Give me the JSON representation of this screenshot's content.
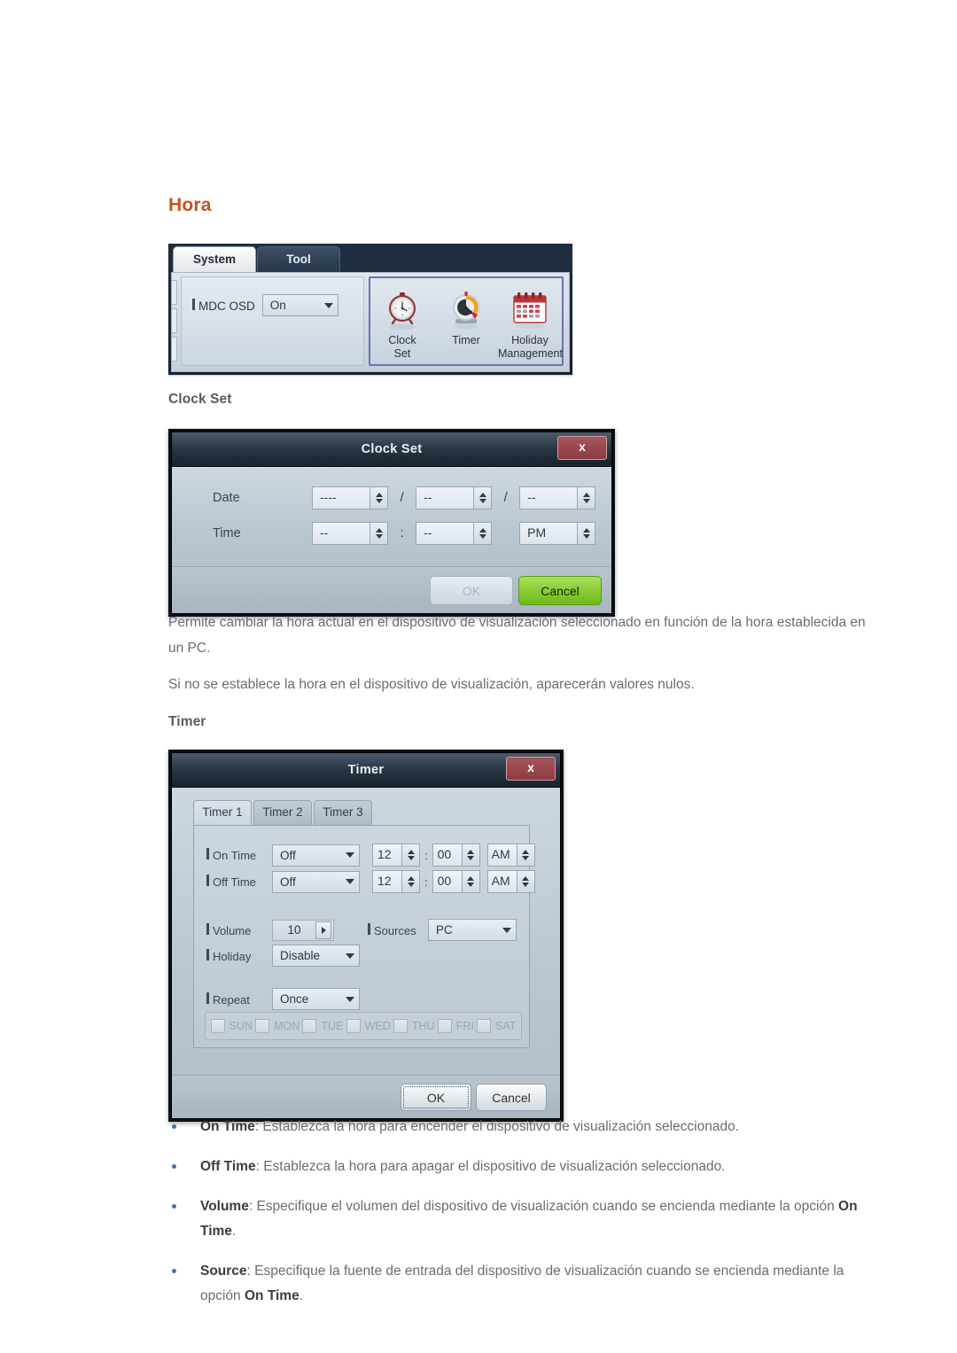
{
  "page": {
    "section_heading": "Hora",
    "sub_clock": "Clock Set",
    "sub_timer": "Timer",
    "accent_color": "#c0551e"
  },
  "ribbon": {
    "tabs": [
      {
        "label": "System",
        "active": true
      },
      {
        "label": "Tool",
        "active": false
      }
    ],
    "osd": {
      "label": "MDC OSD",
      "value": "On"
    },
    "icons": [
      {
        "name": "clock-set-icon",
        "line1": "Clock",
        "line2": "Set"
      },
      {
        "name": "timer-icon",
        "line1": "Timer",
        "line2": ""
      },
      {
        "name": "holiday-management-icon",
        "line1": "Holiday",
        "line2": "Management"
      }
    ]
  },
  "clock_dialog": {
    "title": "Clock Set",
    "close_label": "x",
    "date_label": "Date",
    "time_label": "Time",
    "date": {
      "year": "----",
      "month": "--",
      "day": "--"
    },
    "time": {
      "hour": "--",
      "minute": "--",
      "meridiem": "PM"
    },
    "sep_date": "/",
    "sep_time": ":",
    "ok_label": "OK",
    "cancel_label": "Cancel"
  },
  "timer_dialog": {
    "title": "Timer",
    "close_label": "x",
    "tabs": [
      {
        "label": "Timer 1",
        "active": true
      },
      {
        "label": "Timer 2",
        "active": false
      },
      {
        "label": "Timer 3",
        "active": false
      }
    ],
    "on_time": {
      "label": "On Time",
      "mode": "Off",
      "hour": "12",
      "minute": "00",
      "meridiem": "AM"
    },
    "off_time": {
      "label": "Off Time",
      "mode": "Off",
      "hour": "12",
      "minute": "00",
      "meridiem": "AM"
    },
    "time_sep": ":",
    "volume": {
      "label": "Volume",
      "value": "10"
    },
    "sources": {
      "label": "Sources",
      "value": "PC"
    },
    "holiday": {
      "label": "Holiday",
      "value": "Disable"
    },
    "repeat": {
      "label": "Repeat",
      "value": "Once"
    },
    "days": [
      {
        "label": "SUN",
        "checked": false
      },
      {
        "label": "MON",
        "checked": false
      },
      {
        "label": "TUE",
        "checked": false
      },
      {
        "label": "WED",
        "checked": false
      },
      {
        "label": "THU",
        "checked": false
      },
      {
        "label": "FRI",
        "checked": false
      },
      {
        "label": "SAT",
        "checked": false
      }
    ],
    "ok_label": "OK",
    "cancel_label": "Cancel"
  },
  "body": {
    "para1": "Permite cambiar la hora actual en el dispositivo de visualización seleccionado en función de la hora establecida en un PC.",
    "para2": "Si no se establece la hora en el dispositivo de visualización, aparecerán valores nulos."
  },
  "bullets": [
    {
      "term": "On Time",
      "text": ": Establezca la hora para encender el dispositivo de visualización seleccionado."
    },
    {
      "term": "Off Time",
      "text": ": Establezca la hora para apagar el dispositivo de visualización seleccionado."
    },
    {
      "term": "Volume",
      "text": ": Especifique el volumen del dispositivo de visualización cuando se encienda mediante la opción ",
      "term2": "On Time",
      "text2": "."
    },
    {
      "term": "Source",
      "text": ": Especifique la fuente de entrada del dispositivo de visualización cuando se encienda mediante la opción ",
      "term2": "On Time",
      "text2": "."
    }
  ]
}
